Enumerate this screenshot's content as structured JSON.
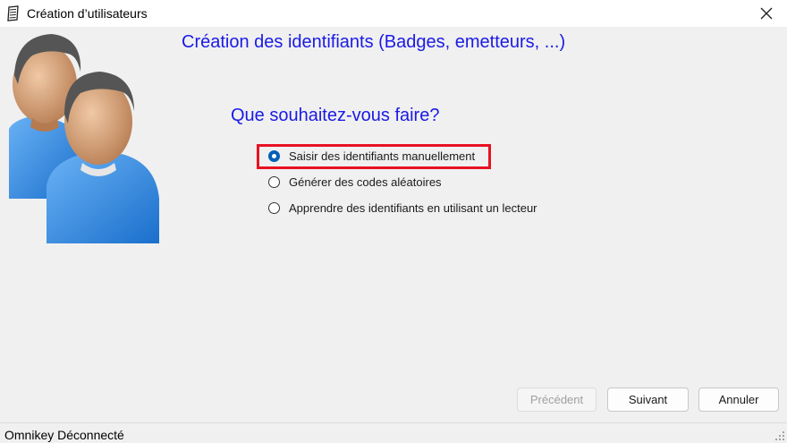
{
  "window": {
    "title": "Création d’utilisateurs",
    "icon": "notepad-icon",
    "close_icon": "close-icon"
  },
  "header": {
    "title": "Création des identifiants (Badges, emetteurs, ...)",
    "illustration": "users-icon"
  },
  "main": {
    "question": "Que souhaitez-vous faire?",
    "options": [
      {
        "label": "Saisir des identifiants manuellement",
        "selected": true
      },
      {
        "label": "Générer des codes aléatoires",
        "selected": false
      },
      {
        "label": "Apprendre des identifiants en utilisant un lecteur",
        "selected": false
      }
    ]
  },
  "buttons": {
    "previous": {
      "label": "Précédent",
      "enabled": false
    },
    "next": {
      "label": "Suivant",
      "enabled": true
    },
    "cancel": {
      "label": "Annuler",
      "enabled": true
    }
  },
  "status": {
    "text": "Omnikey Déconnecté"
  },
  "colors": {
    "heading": "#1a1ae6",
    "highlight": "#e81123",
    "radio_accent": "#005fb8",
    "shirt": "#3a8fe0",
    "skin": "#d9a47a",
    "hair": "#555555"
  }
}
